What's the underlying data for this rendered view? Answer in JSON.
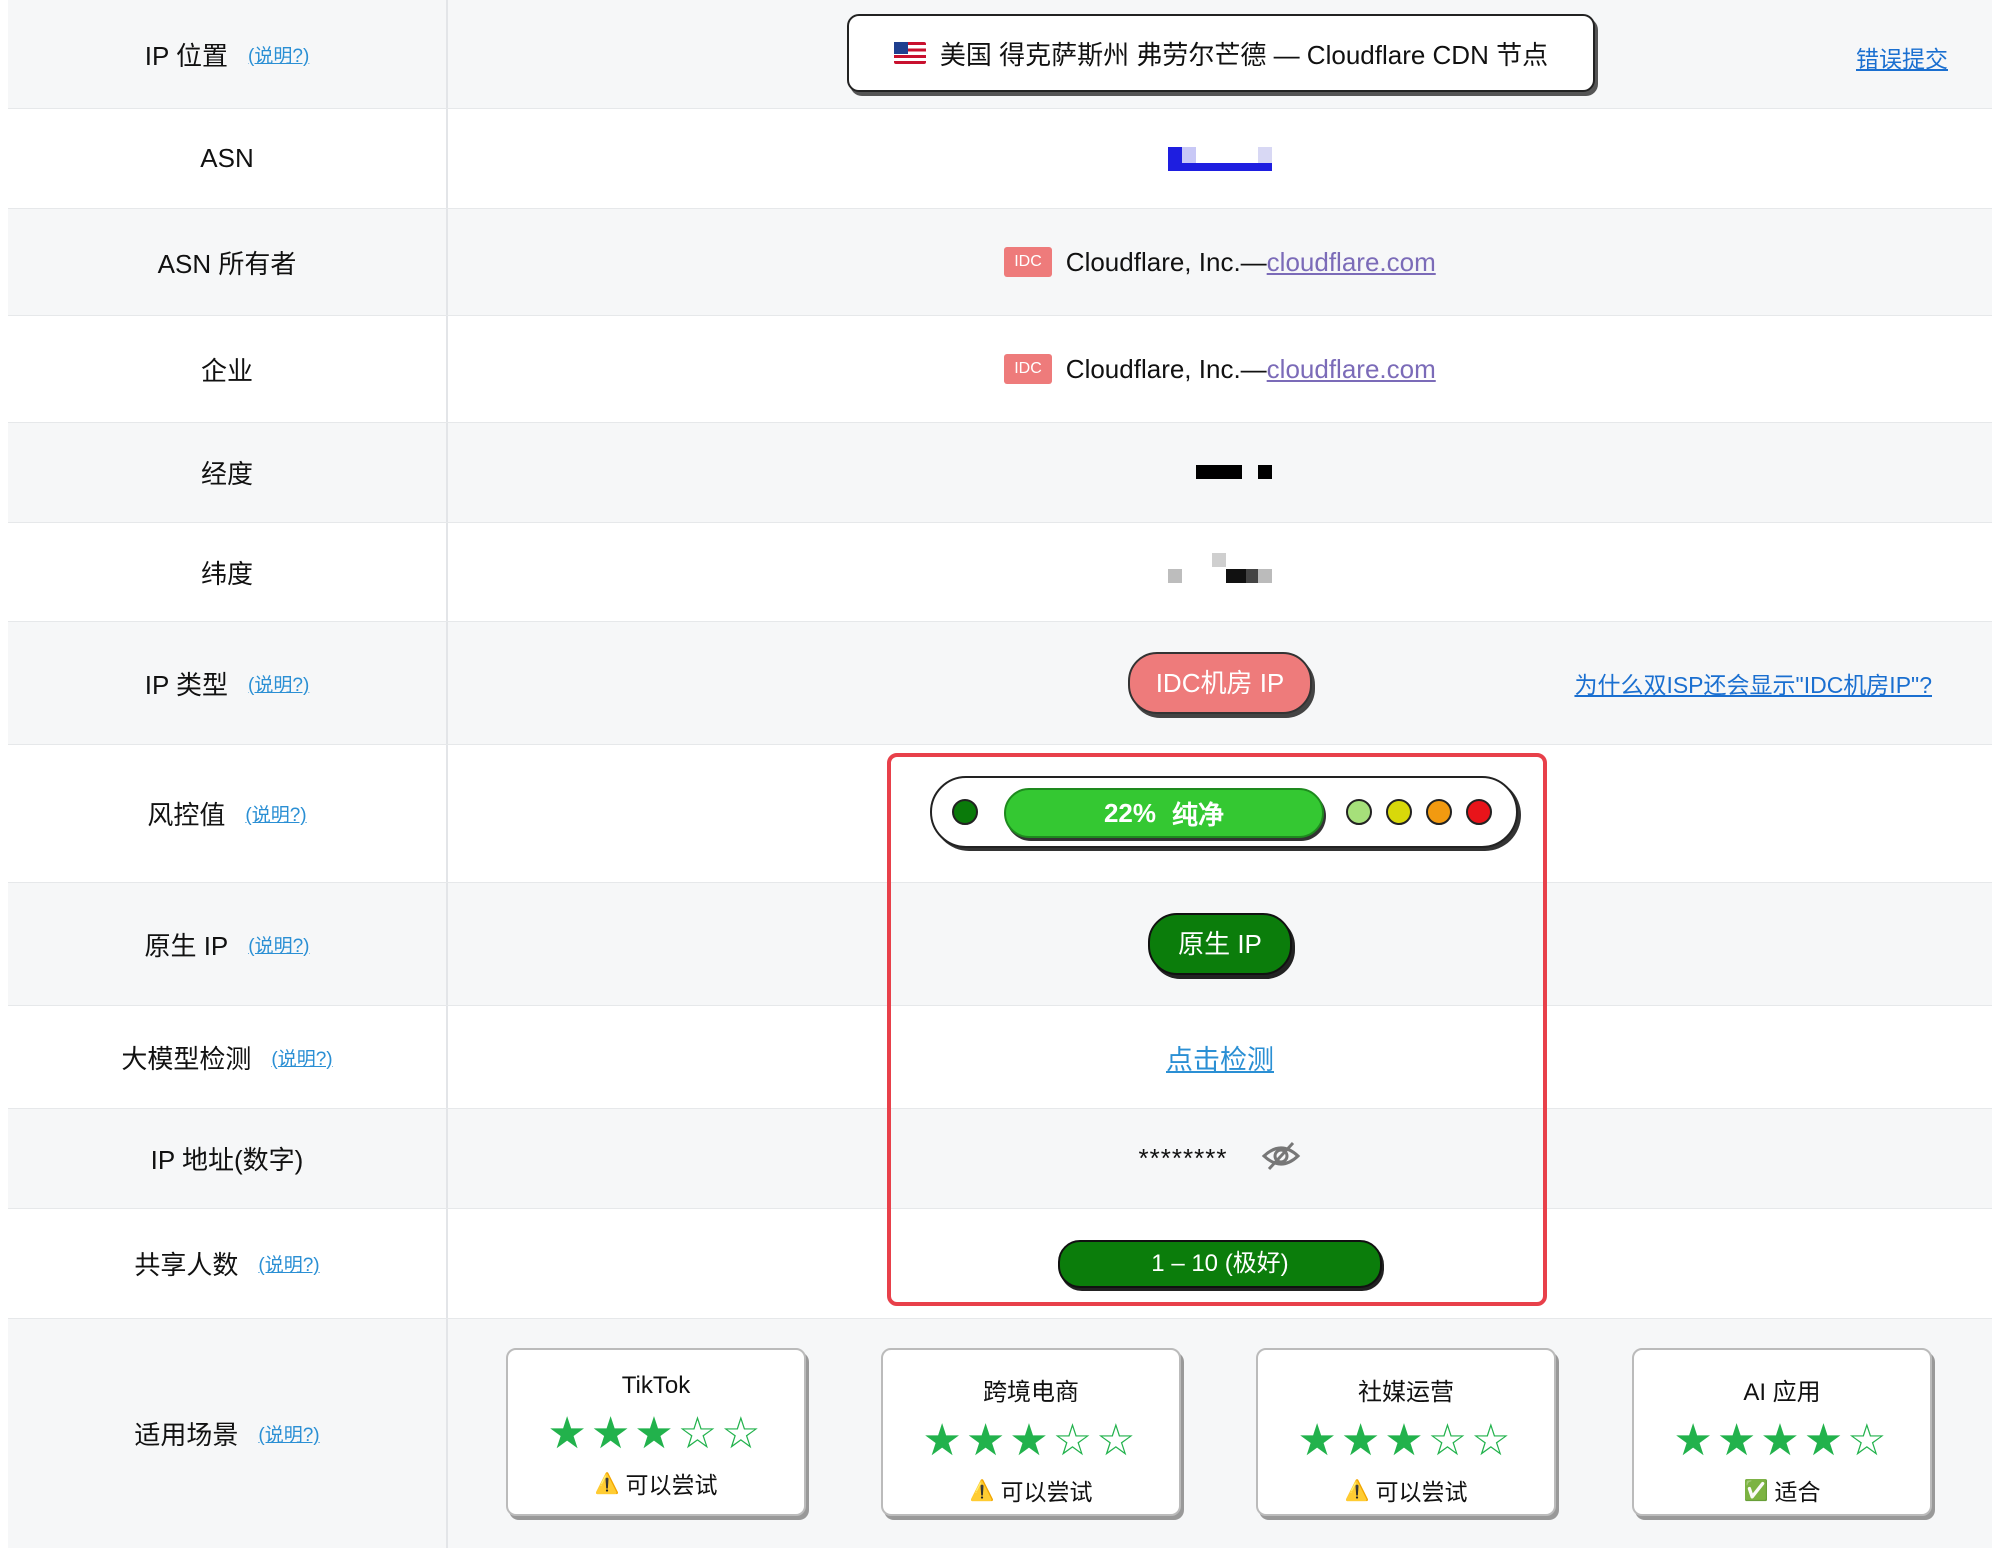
{
  "rows": {
    "ip_location": {
      "label": "IP 位置",
      "help": "(说明?)",
      "value": "美国 得克萨斯州 弗劳尔芒德 — Cloudflare CDN 节点",
      "link": "错误提交"
    },
    "asn": {
      "label": "ASN"
    },
    "asn_owner": {
      "label": "ASN 所有者",
      "tag": "IDC",
      "name": "Cloudflare, Inc.—",
      "domain": "cloudflare.com"
    },
    "enterprise": {
      "label": "企业",
      "tag": "IDC",
      "name": "Cloudflare, Inc.—",
      "domain": "cloudflare.com"
    },
    "longitude": {
      "label": "经度"
    },
    "latitude": {
      "label": "纬度"
    },
    "ip_type": {
      "label": "IP 类型",
      "help": "(说明?)",
      "value": "IDC机房 IP",
      "link": "为什么双ISP还会显示\"IDC机房IP\"?"
    },
    "risk": {
      "label": "风控值",
      "help": "(说明?)",
      "percent": "22%",
      "text": "纯净",
      "value": 22,
      "dot_colors": [
        "#0a7a0a",
        "#a6e07a",
        "#d8d80a",
        "#f29a10",
        "#e8141a"
      ]
    },
    "native": {
      "label": "原生 IP",
      "help": "(说明?)",
      "value": "原生 IP"
    },
    "llm": {
      "label": "大模型检测",
      "help": "(说明?)",
      "value": "点击检测"
    },
    "ip_numeric": {
      "label": "IP 地址(数字)",
      "value": "********"
    },
    "shared": {
      "label": "共享人数",
      "help": "(说明?)",
      "value": "1 – 10 (极好)"
    },
    "scenes": {
      "label": "适用场景",
      "help": "(说明?)",
      "cards": [
        {
          "title": "TikTok",
          "stars": "★★★☆☆",
          "rating": 3,
          "status": "可以尝试",
          "icon": "warning-icon"
        },
        {
          "title": "跨境电商",
          "stars": "★★★☆☆",
          "rating": 3,
          "status": "可以尝试",
          "icon": "warning-icon"
        },
        {
          "title": "社媒运营",
          "stars": "★★★☆☆",
          "rating": 3,
          "status": "可以尝试",
          "icon": "warning-icon"
        },
        {
          "title": "AI 应用",
          "stars": "★★★★☆",
          "rating": 4,
          "status": "适合",
          "icon": "check-icon"
        }
      ]
    }
  },
  "colors": {
    "accent_link": "#2a8fd4",
    "idc_red": "#ee7b7b",
    "native_green": "#0b7d0b",
    "risk_green": "#34c832",
    "star_green": "#22b24c",
    "highlight_red": "#e8404a"
  }
}
